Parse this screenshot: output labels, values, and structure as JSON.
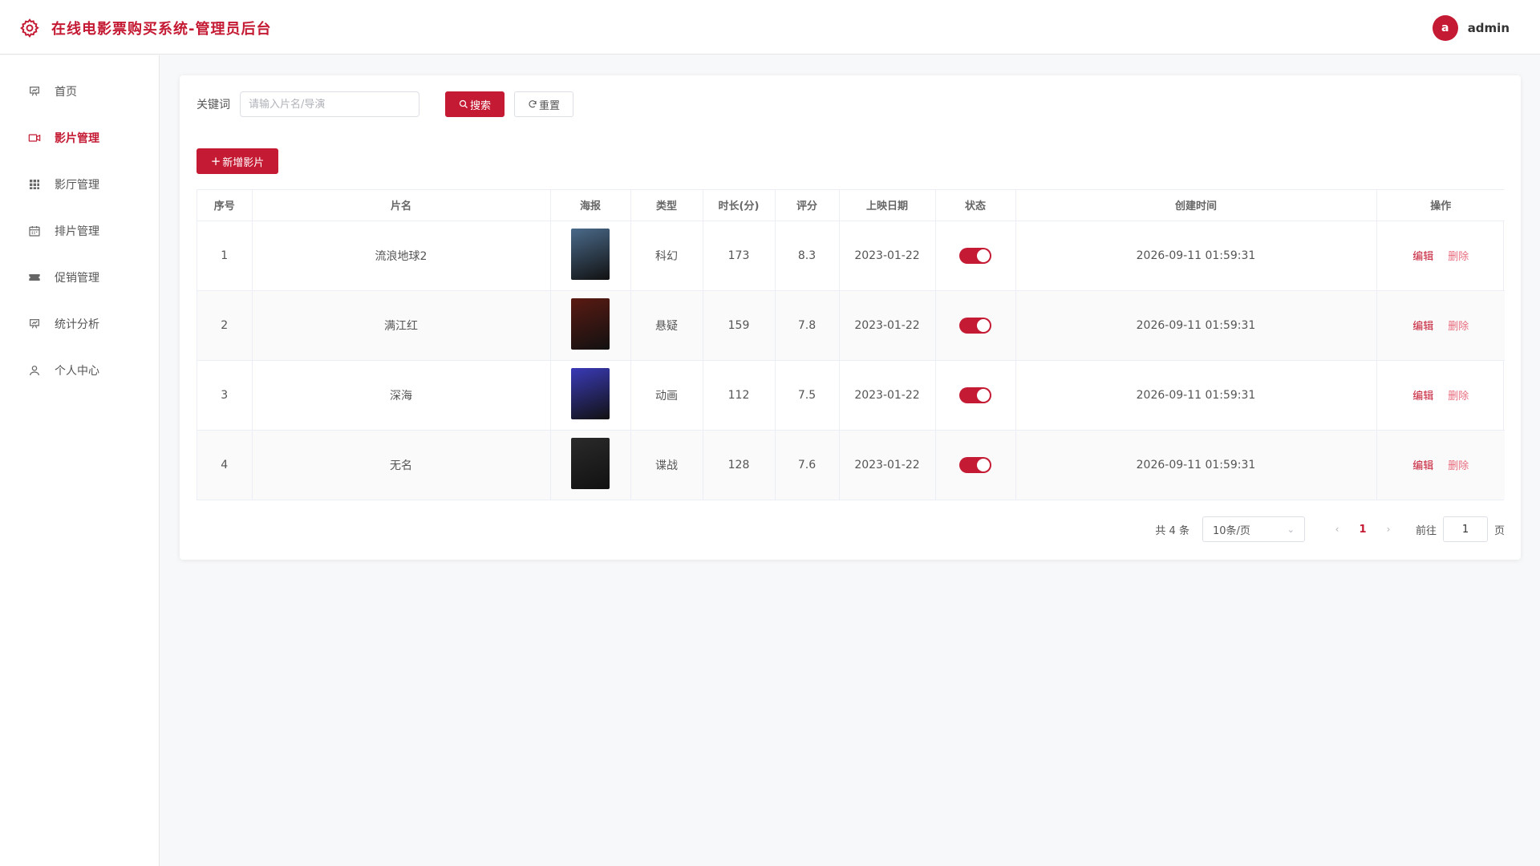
{
  "header": {
    "title": "在线电影票购买系统-管理员后台",
    "avatar_letter": "a",
    "username": "admin"
  },
  "sidebar": {
    "items": [
      {
        "label": "首页",
        "icon": "presentation-chart-icon",
        "active": false
      },
      {
        "label": "影片管理",
        "icon": "video-camera-icon",
        "active": true
      },
      {
        "label": "影厅管理",
        "icon": "grid-icon",
        "active": false
      },
      {
        "label": "排片管理",
        "icon": "calendar-icon",
        "active": false
      },
      {
        "label": "促销管理",
        "icon": "ticket-icon",
        "active": false
      },
      {
        "label": "统计分析",
        "icon": "presentation-chart-icon",
        "active": false
      },
      {
        "label": "个人中心",
        "icon": "user-icon",
        "active": false
      }
    ]
  },
  "search": {
    "label": "关键词",
    "placeholder": "请输入片名/导演",
    "value": "",
    "search_label": "搜索",
    "reset_label": "重置"
  },
  "toolbar": {
    "add_label": "新增影片"
  },
  "table": {
    "columns": [
      "序号",
      "片名",
      "海报",
      "类型",
      "时长(分)",
      "评分",
      "上映日期",
      "状态",
      "创建时间",
      "操作"
    ],
    "rows": [
      {
        "index": "1",
        "name": "流浪地球2",
        "poster_color": "#4a6a8a",
        "genre": "科幻",
        "duration": "173",
        "rating": "8.3",
        "release": "2023-01-22",
        "status_on": true,
        "created": "2026-09-11 01:59:31"
      },
      {
        "index": "2",
        "name": "满江红",
        "poster_color": "#5a1a12",
        "genre": "悬疑",
        "duration": "159",
        "rating": "7.8",
        "release": "2023-01-22",
        "status_on": true,
        "created": "2026-09-11 01:59:31"
      },
      {
        "index": "3",
        "name": "深海",
        "poster_color": "#3a3ab8",
        "genre": "动画",
        "duration": "112",
        "rating": "7.5",
        "release": "2023-01-22",
        "status_on": true,
        "created": "2026-09-11 01:59:31"
      },
      {
        "index": "4",
        "name": "无名",
        "poster_color": "#2a2a2a",
        "genre": "谍战",
        "duration": "128",
        "rating": "7.6",
        "release": "2023-01-22",
        "status_on": true,
        "created": "2026-09-11 01:59:31"
      }
    ],
    "edit_label": "编辑",
    "delete_label": "删除"
  },
  "pagination": {
    "total_text": "共 4 条",
    "page_size": "10条/页",
    "current_page": "1",
    "goto_label": "前往",
    "goto_value": "1",
    "page_suffix": "页"
  },
  "colors": {
    "accent": "#c41a33",
    "delete": "#e86b7d"
  }
}
